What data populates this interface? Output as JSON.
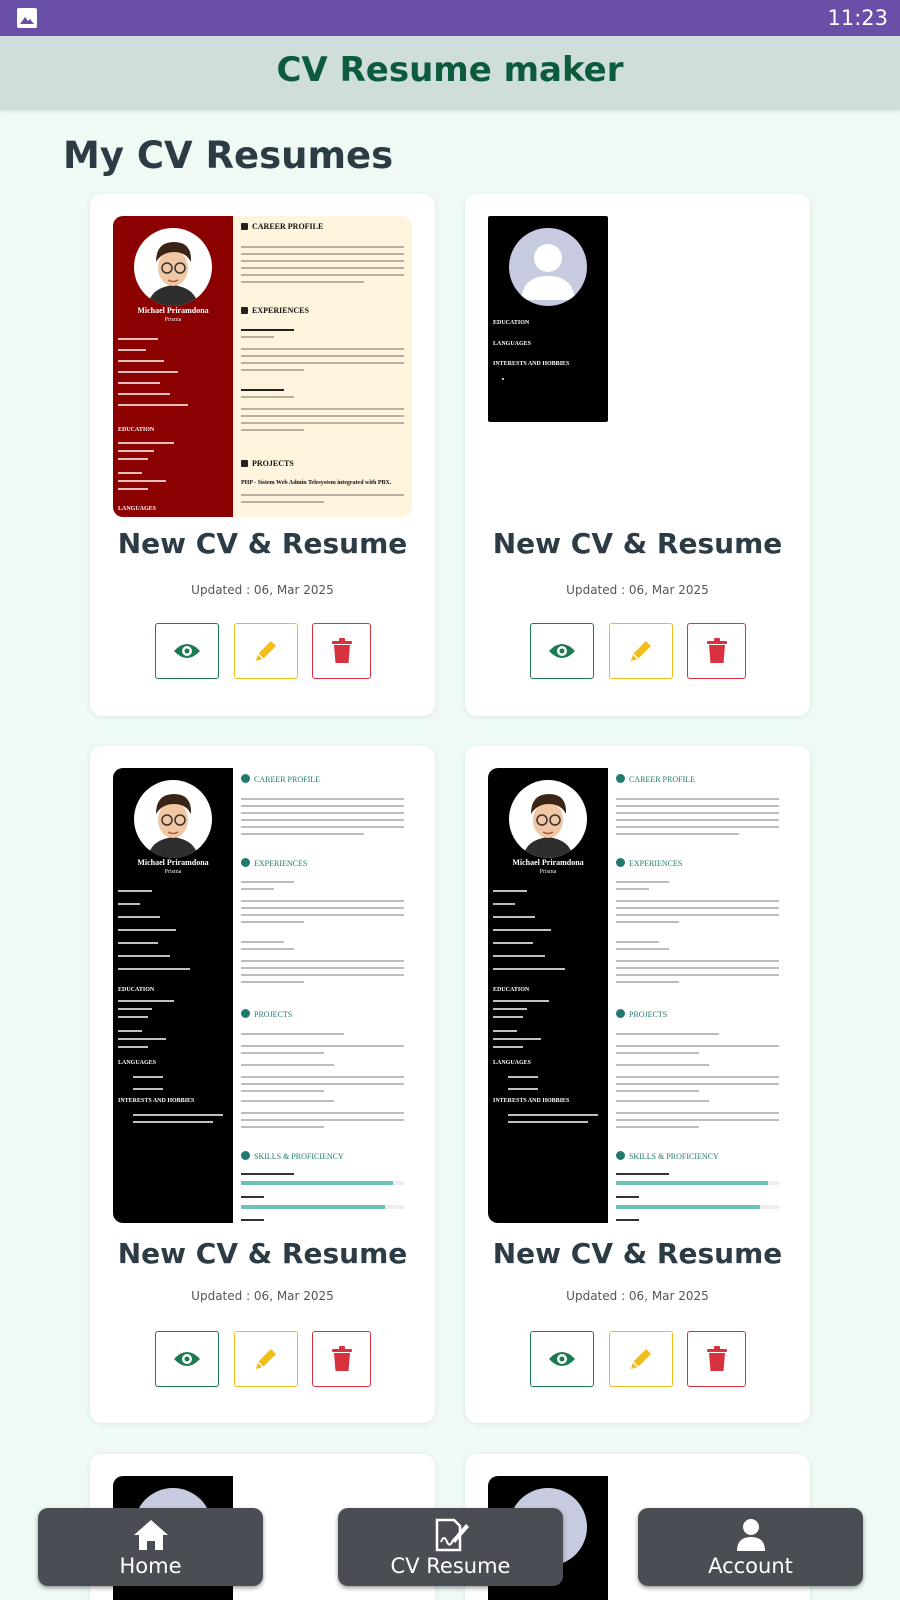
{
  "status_bar": {
    "time": "11:23",
    "notification_icon": "image-icon"
  },
  "app_bar": {
    "title": "CV Resume maker"
  },
  "section_title": "My CV Resumes",
  "cv_preview": {
    "name": "Michael Priramdona",
    "role": "Prisma",
    "headings": {
      "career_profile": "CAREER PROFILE",
      "experiences": "EXPERIENCES",
      "projects": "PROJECTS",
      "skills": "SKILLS & PROFICIENCY",
      "education": "EDUCATION",
      "languages": "LANGUAGES",
      "interests": "INTERESTS AND HOBBIES"
    },
    "red_project_line": "PHP - Sistem Web Admin Telesystem integrated with PBX."
  },
  "cards": [
    {
      "title": "New CV & Resume",
      "updated": "Updated : 06, Mar 2025",
      "template": "red"
    },
    {
      "title": "New CV & Resume",
      "updated": "Updated : 06, Mar 2025",
      "template": "blank"
    },
    {
      "title": "New CV & Resume",
      "updated": "Updated : 06, Mar 2025",
      "template": "dark"
    },
    {
      "title": "New CV & Resume",
      "updated": "Updated : 06, Mar 2025",
      "template": "dark"
    }
  ],
  "actions": {
    "view_icon": "eye-icon",
    "edit_icon": "pencil-icon",
    "delete_icon": "trash-icon"
  },
  "colors": {
    "primary": "#0d5b3d",
    "view": "#1c7a4f",
    "edit": "#f2bd1b",
    "delete": "#d9323f",
    "status_bar": "#6a4fa8"
  },
  "bottom_nav": [
    {
      "label": "Home",
      "icon": "home-icon"
    },
    {
      "label": "CV Resume",
      "icon": "signature-icon"
    },
    {
      "label": "Account",
      "icon": "user-icon"
    }
  ]
}
